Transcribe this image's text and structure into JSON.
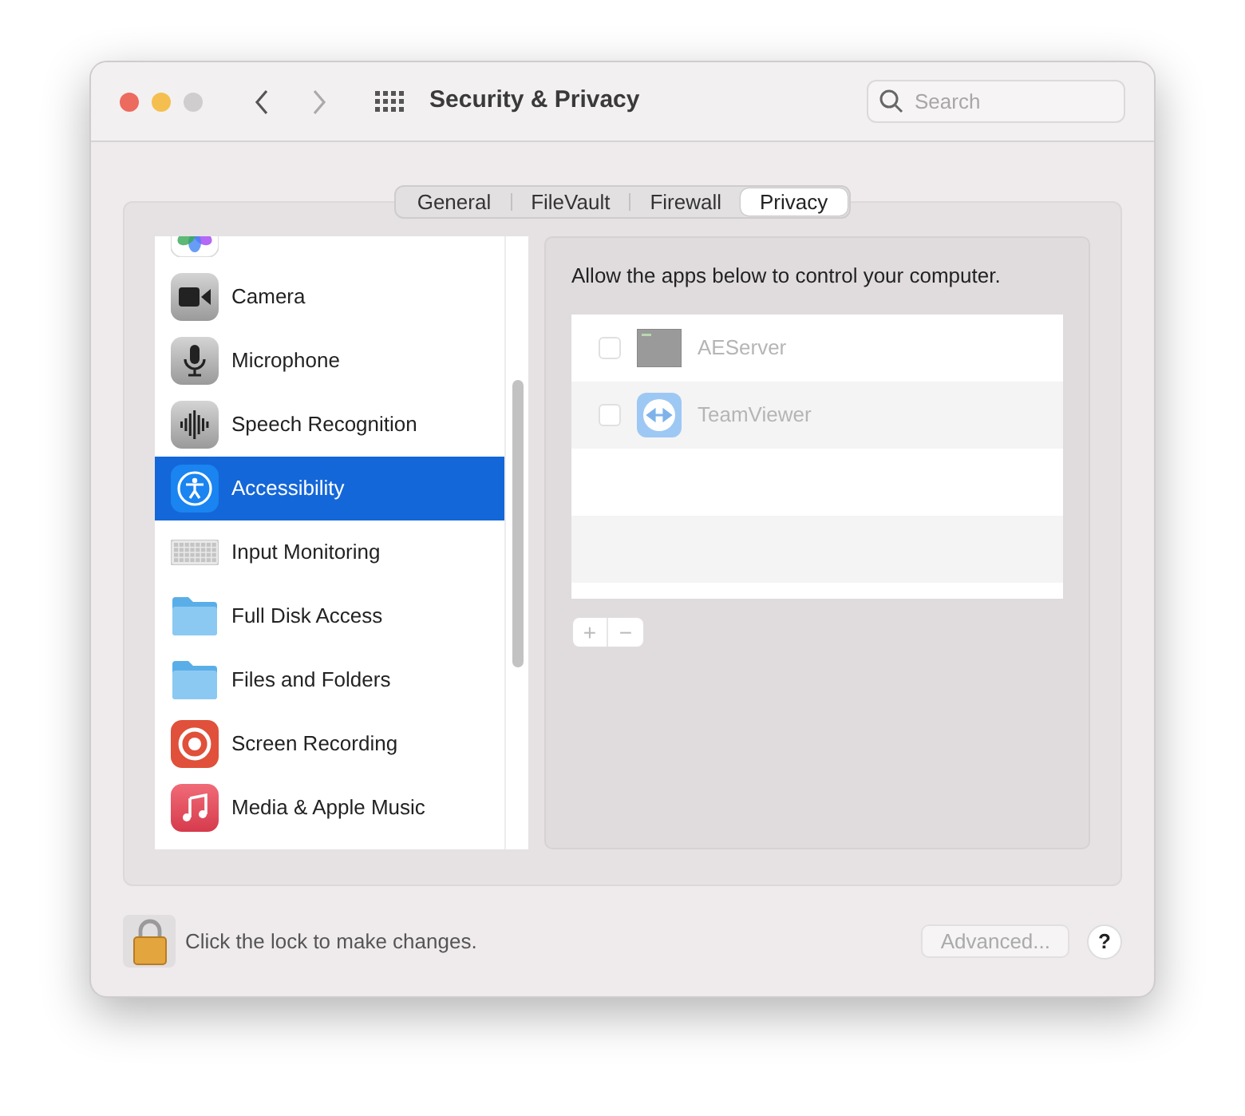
{
  "window": {
    "title": "Security & Privacy"
  },
  "search": {
    "placeholder": "Search"
  },
  "tabs": [
    {
      "label": "General",
      "selected": false
    },
    {
      "label": "FileVault",
      "selected": false
    },
    {
      "label": "Firewall",
      "selected": false
    },
    {
      "label": "Privacy",
      "selected": true
    }
  ],
  "sidebar": {
    "items": [
      {
        "kind": "photos",
        "selected": false
      },
      {
        "label": "Camera",
        "kind": "camera",
        "selected": false
      },
      {
        "label": "Microphone",
        "kind": "microphone",
        "selected": false
      },
      {
        "label": "Speech Recognition",
        "kind": "speech",
        "selected": false
      },
      {
        "label": "Accessibility",
        "kind": "accessibility",
        "selected": true
      },
      {
        "label": "Input Monitoring",
        "kind": "keyboard",
        "selected": false
      },
      {
        "label": "Full Disk Access",
        "kind": "folder",
        "selected": false
      },
      {
        "label": "Files and Folders",
        "kind": "folder",
        "selected": false
      },
      {
        "label": "Screen Recording",
        "kind": "record",
        "selected": false
      },
      {
        "label": "Media & Apple Music",
        "kind": "music",
        "selected": false
      }
    ]
  },
  "panel": {
    "description": "Allow the apps below to control your computer.",
    "apps": [
      {
        "name": "AEServer",
        "kind": "terminal",
        "checked": false,
        "disabled": true
      },
      {
        "name": "TeamViewer",
        "kind": "teamviewer",
        "checked": false,
        "disabled": true
      }
    ],
    "add_label": "+",
    "remove_label": "−"
  },
  "footer": {
    "lock_text": "Click the lock to make changes.",
    "advanced": {
      "label": "Advanced...",
      "disabled": true
    },
    "help": "?"
  }
}
